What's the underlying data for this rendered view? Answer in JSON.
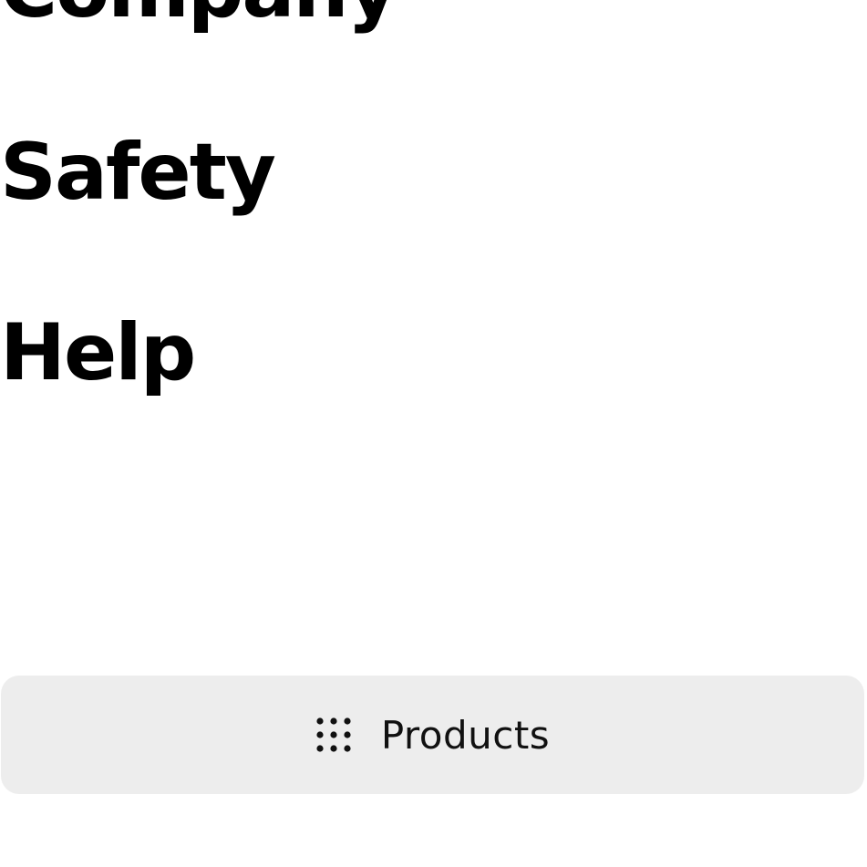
{
  "nav": {
    "items": [
      {
        "label": "Company"
      },
      {
        "label": "Safety"
      },
      {
        "label": "Help"
      }
    ]
  },
  "products_button": {
    "label": "Products",
    "icon": "grid-dots-icon",
    "background": "#ededed"
  },
  "icons": {
    "chevron": "chevron-down-icon"
  }
}
